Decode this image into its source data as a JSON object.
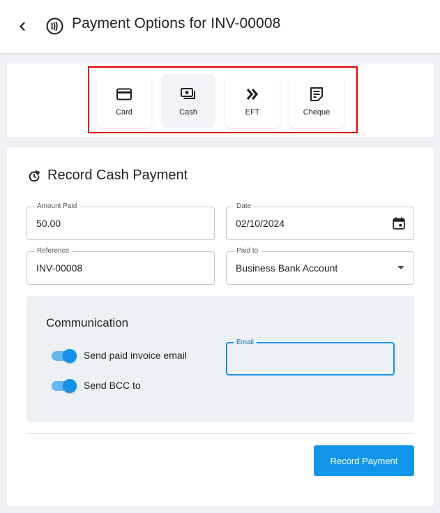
{
  "header": {
    "back_icon": "chevron-left-icon",
    "title_icon": "contactless-payment-icon",
    "title": "Payment Options for INV-00008"
  },
  "payment_methods": [
    {
      "label": "Card",
      "icon": "credit-card-icon",
      "selected": false
    },
    {
      "label": "Cash",
      "icon": "cash-icon",
      "selected": true
    },
    {
      "label": "EFT",
      "icon": "double-chevron-right-icon",
      "selected": false
    },
    {
      "label": "Cheque",
      "icon": "cheque-icon",
      "selected": false
    }
  ],
  "form": {
    "section_icon": "refresh-icon",
    "section_title": "Record Cash Payment",
    "amount": {
      "label": "Amount Paid",
      "value": "50.00"
    },
    "date": {
      "label": "Date",
      "value": "02/10/2024"
    },
    "reference": {
      "label": "Reference",
      "value": "INV-00008"
    },
    "paid_to": {
      "label": "Paid to",
      "value": "Business Bank Account"
    }
  },
  "communication": {
    "title": "Communication",
    "send_paid_invoice_email": {
      "label": "Send paid invoice email",
      "on": true
    },
    "send_bcc": {
      "label": "Send BCC to",
      "on": true
    },
    "email": {
      "label": "Email",
      "value": ""
    }
  },
  "actions": {
    "record_payment_label": "Record Payment"
  },
  "colors": {
    "accent": "#1296ec",
    "toggle_track": "#66b8f2",
    "highlight_border": "#e00000",
    "panel_bg": "#edf0f5"
  }
}
